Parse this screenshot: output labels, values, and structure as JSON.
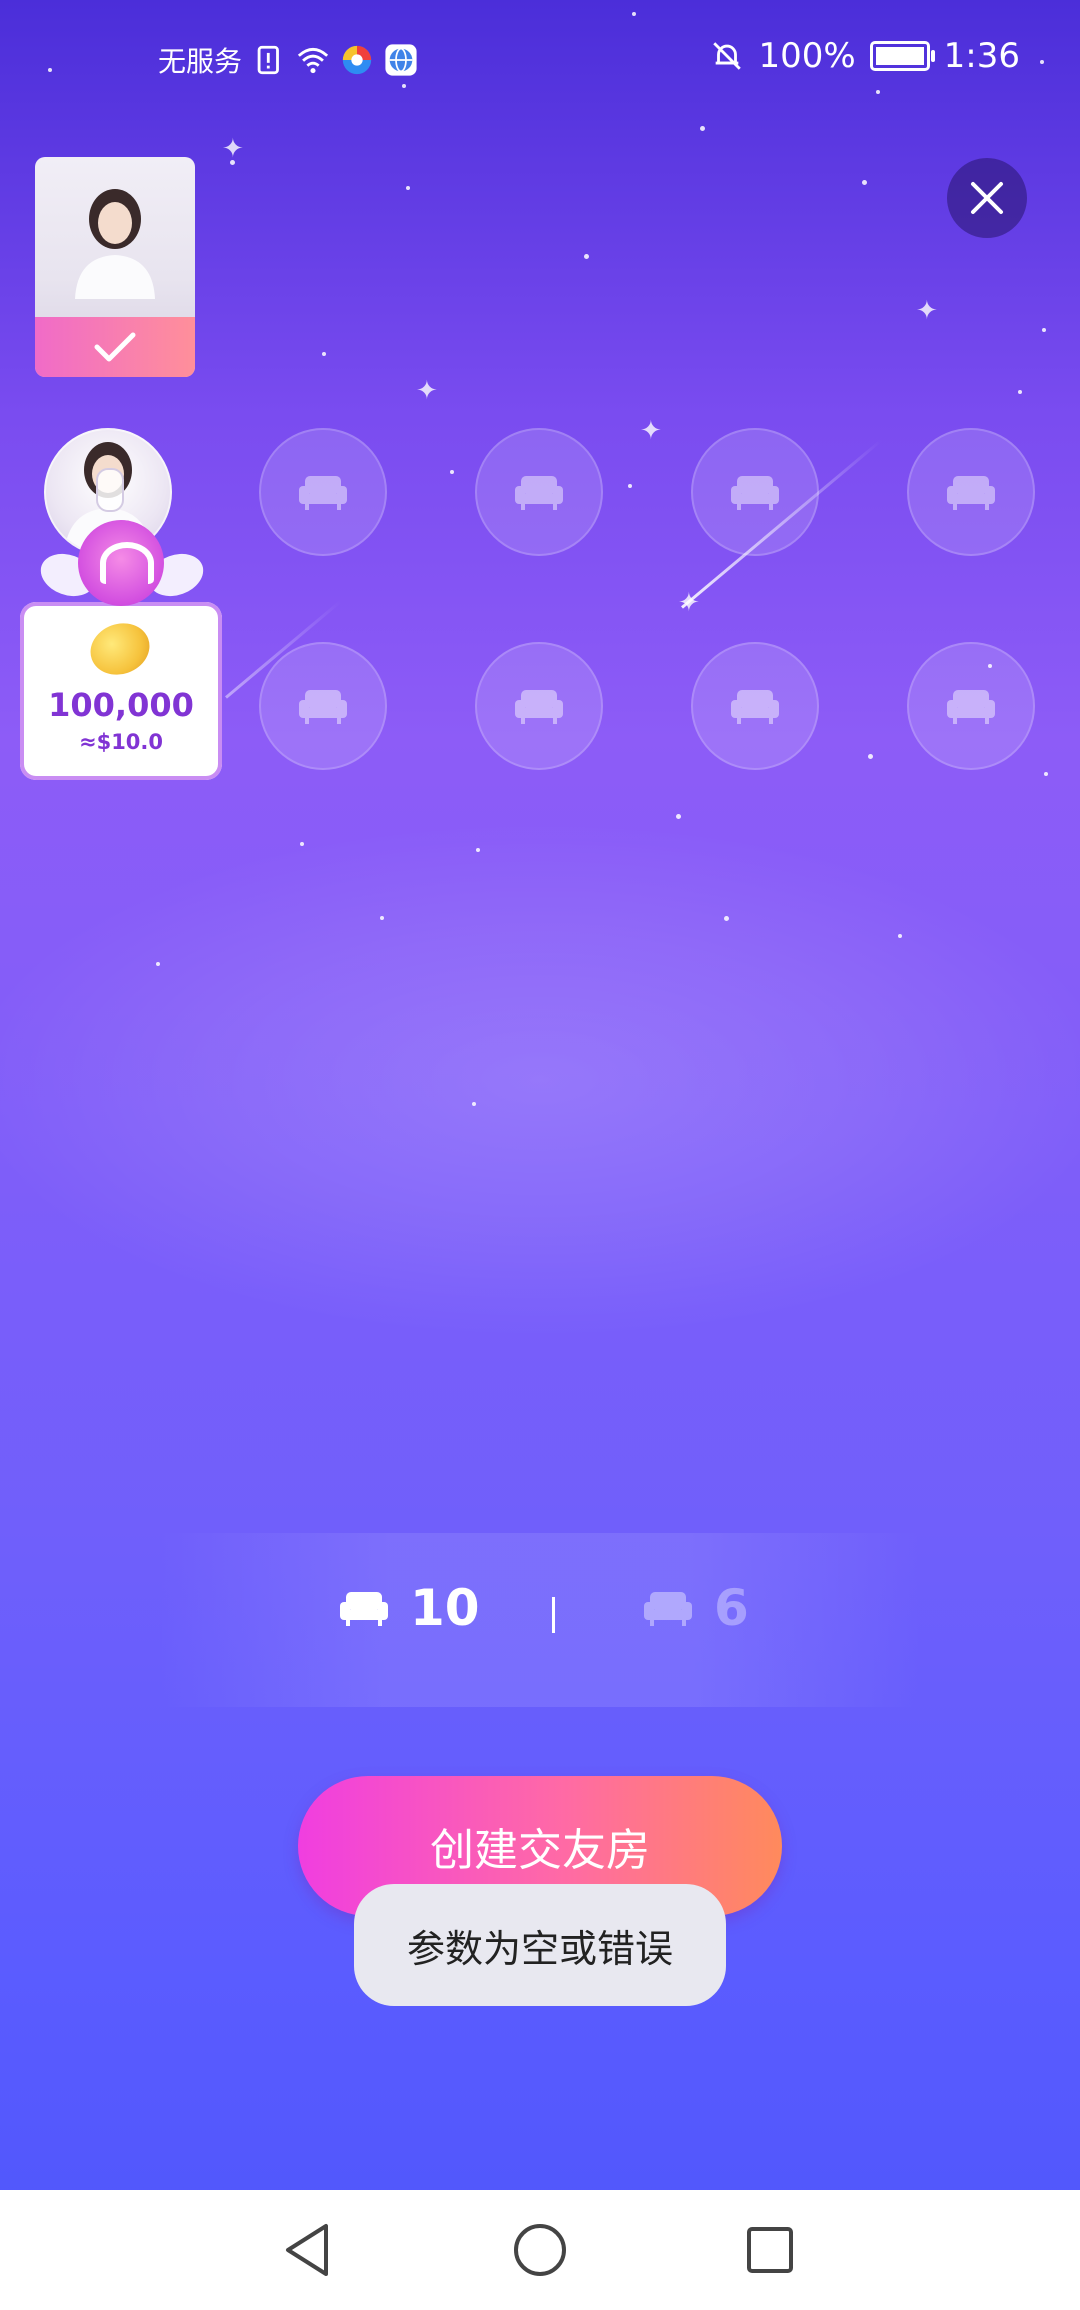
{
  "status_bar": {
    "carrier": "无服务",
    "battery_percent": "100%",
    "time": "1:36",
    "icons": [
      "sim-alert-icon",
      "wifi-icon",
      "browser-app-icon",
      "globe-app-icon",
      "mute-bell-icon",
      "battery-icon"
    ]
  },
  "cover": {
    "icon": "check-icon",
    "selected": true
  },
  "close": {
    "icon": "close-icon"
  },
  "seats": {
    "host_icon": "microphone-icon",
    "empty_seat_icon": "sofa-icon",
    "rows": [
      [
        "host",
        "empty",
        "empty",
        "empty",
        "empty"
      ],
      [
        "gift",
        "empty",
        "empty",
        "empty",
        "empty"
      ]
    ]
  },
  "gift_card": {
    "amount": "100,000",
    "usd": "≈$10.0",
    "icon": "gold-bean-icon"
  },
  "seat_counter": {
    "option_a": "10",
    "option_b": "6",
    "separator": "|",
    "icon": "sofa-icon",
    "selected": "option_a"
  },
  "actions": {
    "create_label": "创建交友房"
  },
  "toast": {
    "message": "参数为空或错误"
  },
  "nav": {
    "items": [
      "back-triangle-icon",
      "home-circle-icon",
      "recents-square-icon"
    ]
  },
  "colors": {
    "accent_pink": "#f03ee0",
    "accent_orange": "#ff8a5c",
    "gift_purple": "#8134d4"
  }
}
